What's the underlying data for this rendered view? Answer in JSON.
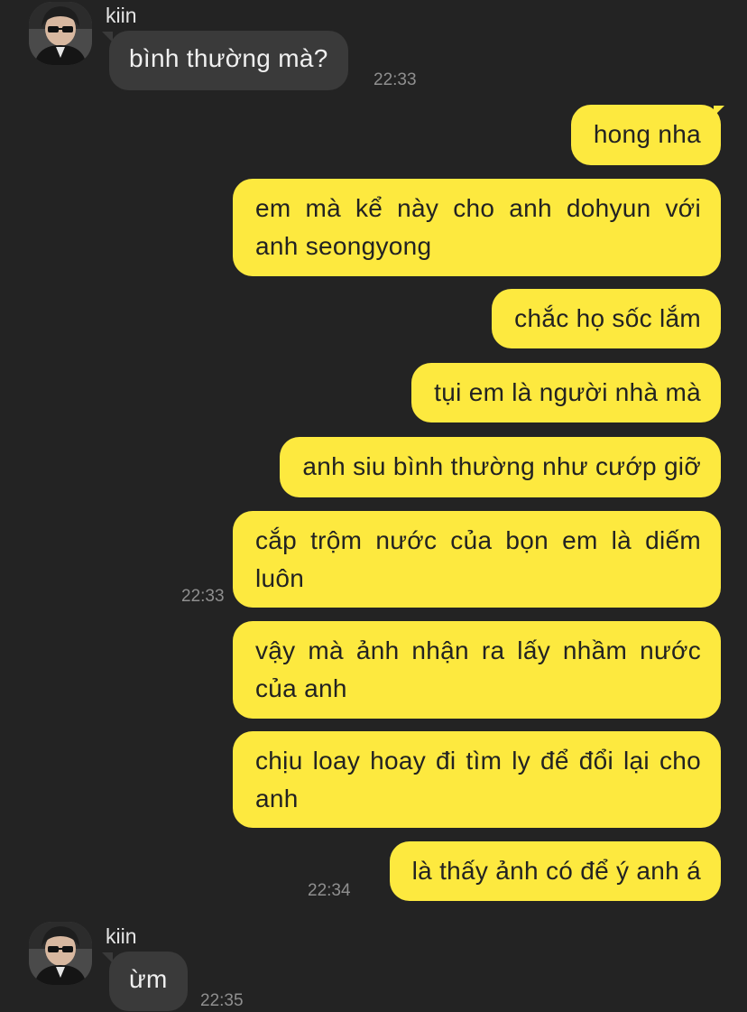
{
  "contact": {
    "name": "kiin"
  },
  "messages": [
    {
      "text": "bình thường mà?",
      "time": "22:33"
    },
    {
      "text": "hong nha"
    },
    {
      "text": "em mà kể này cho anh dohyun với anh seongyong"
    },
    {
      "text": "chắc họ sốc lắm"
    },
    {
      "text": "tụi em là người nhà mà"
    },
    {
      "text": "anh siu bình thường như cướp giỡ"
    },
    {
      "text": "cắp trộm nước của bọn em là diếm luôn",
      "time": "22:33"
    },
    {
      "text": "vậy mà ảnh nhận ra lấy nhầm nước của anh"
    },
    {
      "text": "chịu loay hoay đi tìm ly để đổi lại cho anh"
    },
    {
      "text": "là thấy ảnh có để ý anh á",
      "time": "22:34"
    },
    {
      "text": "ừm",
      "time": "22:35"
    }
  ],
  "colors": {
    "background": "#232323",
    "incoming_bubble": "#3a3a3a",
    "outgoing_bubble": "#fde93f",
    "timestamp": "#8f8f8f"
  },
  "icons": {
    "avatar": "profile-photo"
  }
}
